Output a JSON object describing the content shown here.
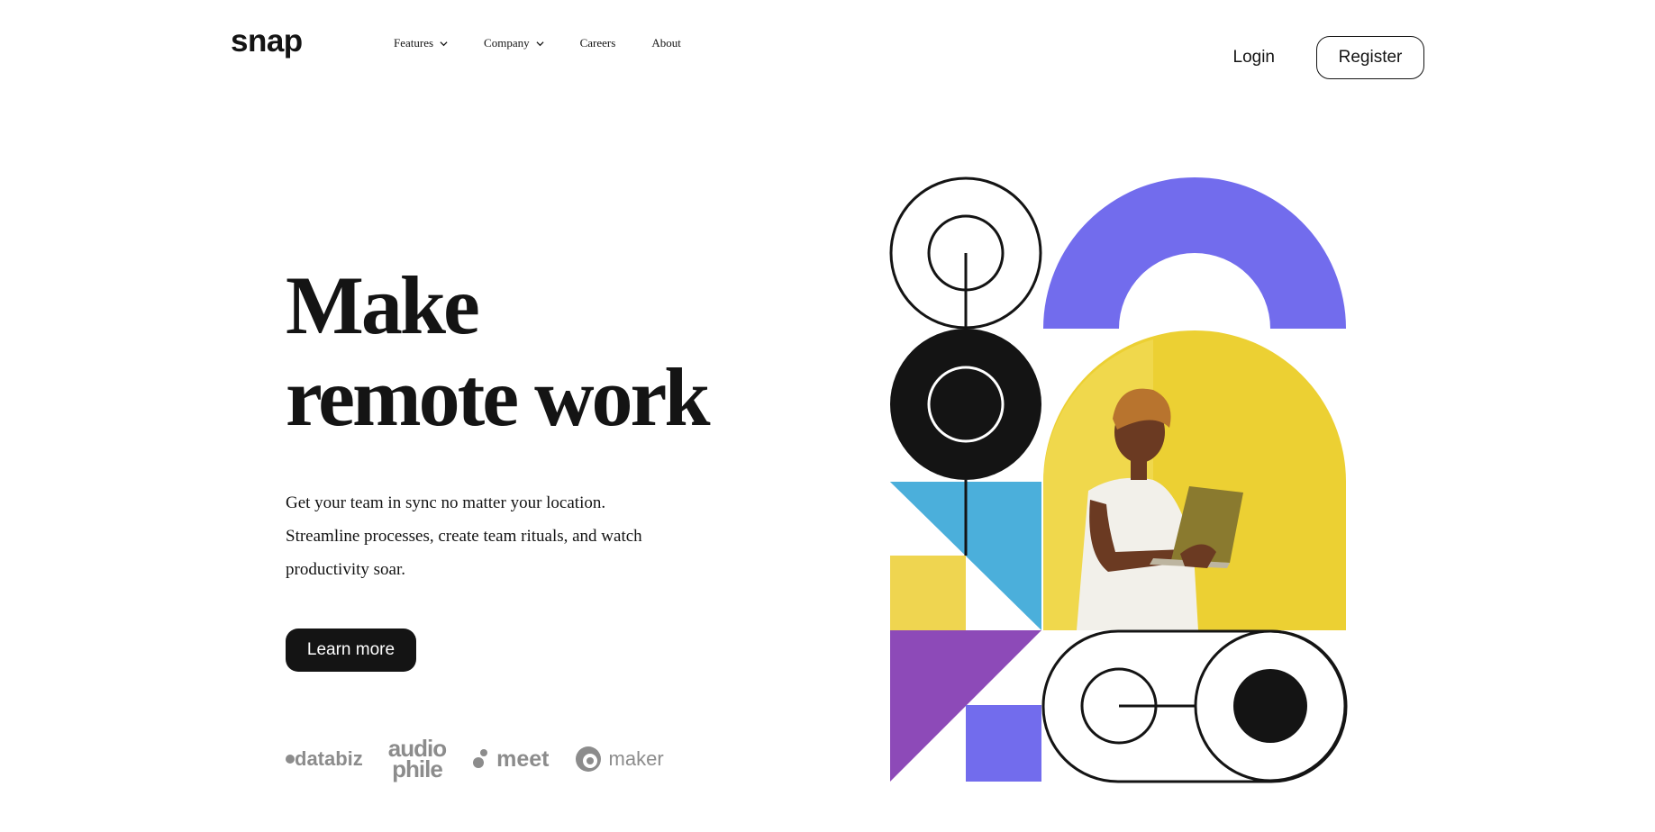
{
  "brand": {
    "name": "snap"
  },
  "nav": {
    "items": [
      {
        "label": "Features",
        "dropdown": true
      },
      {
        "label": "Company",
        "dropdown": true
      },
      {
        "label": "Careers",
        "dropdown": false
      },
      {
        "label": "About",
        "dropdown": false
      }
    ]
  },
  "auth": {
    "login": "Login",
    "register": "Register"
  },
  "hero": {
    "title_line1": "Make",
    "title_line2": "remote work",
    "description_line1": "Get your team in sync no matter your location.",
    "description_line2": "Streamline processes, create team rituals, and watch",
    "description_line3": "productivity soar.",
    "cta": "Learn more"
  },
  "clients": {
    "databiz": "databiz",
    "audiophile_top": "audio",
    "audiophile_bottom": "phile",
    "meet": "meet",
    "maker": "maker"
  },
  "colors": {
    "ink": "#141414",
    "violet": "#726ced",
    "sky": "#4bafdb",
    "mustard": "#efd550",
    "purple": "#8d4ab8",
    "client_gray": "#8c8c8c"
  }
}
